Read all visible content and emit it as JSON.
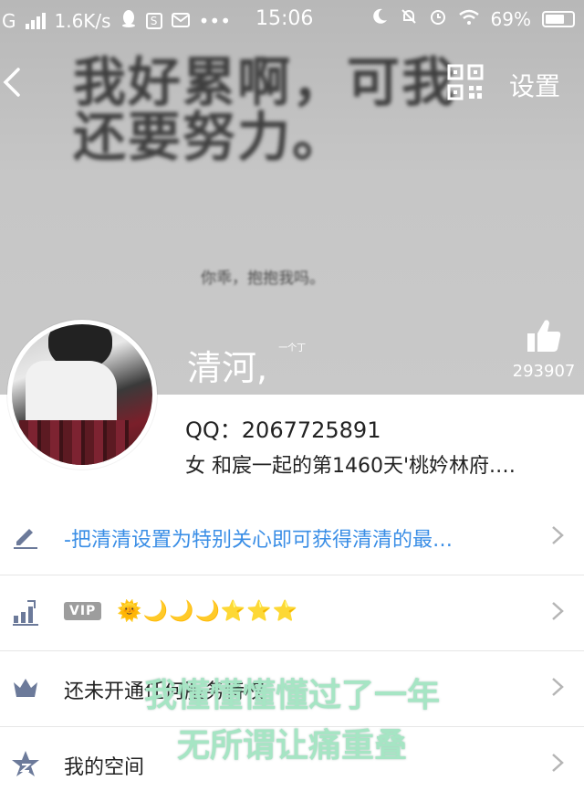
{
  "status_bar": {
    "network": "G",
    "speed": "1.6K/s",
    "time": "15:06",
    "battery": "69%"
  },
  "header": {
    "settings_label": "设置",
    "cover_signature_main": "我好累啊，可我还要努力。",
    "cover_signature_sub": "你乖，抱抱我吗。"
  },
  "profile": {
    "nickname": "清河,",
    "nickname_tail": "一个丁",
    "likes": "293907",
    "qq": "QQ：2067725891",
    "bio": "女 和宸一起的第1460天'桃妗林府.…"
  },
  "rows": [
    {
      "icon": "pencil-icon",
      "text": "-把清清设置为特别关心即可获得清清的最…"
    },
    {
      "icon": "rank-icon",
      "badge": "VIP",
      "level": "🌞🌙🌙🌙⭐⭐⭐"
    },
    {
      "icon": "crown-icon",
      "text": "还未开通任何服务特权"
    },
    {
      "icon": "space-star-icon",
      "text": "我的空间"
    }
  ],
  "overlay": {
    "line1": "我懂懂懂懂过了一年",
    "line2": "无所谓让痛重叠"
  },
  "colors": {
    "accent_blue": "#3a8ee6",
    "overlay_green": "#a6e5c4"
  }
}
